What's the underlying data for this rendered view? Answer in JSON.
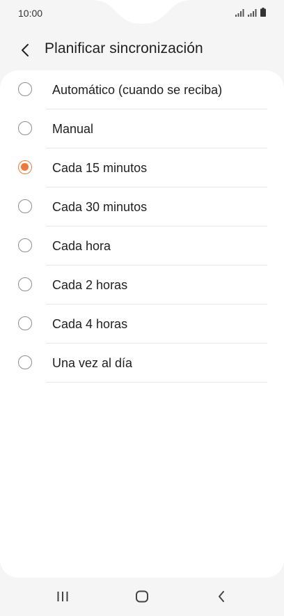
{
  "status_bar": {
    "time": "10:00",
    "icons": [
      "signal-icon",
      "signal-icon",
      "battery-icon"
    ]
  },
  "header": {
    "back_icon": "chevron-left-icon",
    "title": "Planificar sincronización"
  },
  "options": [
    {
      "label": "Automático (cuando se reciba)",
      "checked": false
    },
    {
      "label": "Manual",
      "checked": false
    },
    {
      "label": "Cada 15 minutos",
      "checked": true
    },
    {
      "label": "Cada 30 minutos",
      "checked": false
    },
    {
      "label": "Cada hora",
      "checked": false
    },
    {
      "label": "Cada 2 horas",
      "checked": false
    },
    {
      "label": "Cada 4 horas",
      "checked": false
    },
    {
      "label": "Una vez al día",
      "checked": false
    }
  ],
  "colors": {
    "accent": "#f0793a",
    "background": "#f5f5f5",
    "card": "#ffffff"
  },
  "nav_bar": {
    "icons": [
      "recent-apps-icon",
      "home-icon",
      "back-icon"
    ]
  }
}
